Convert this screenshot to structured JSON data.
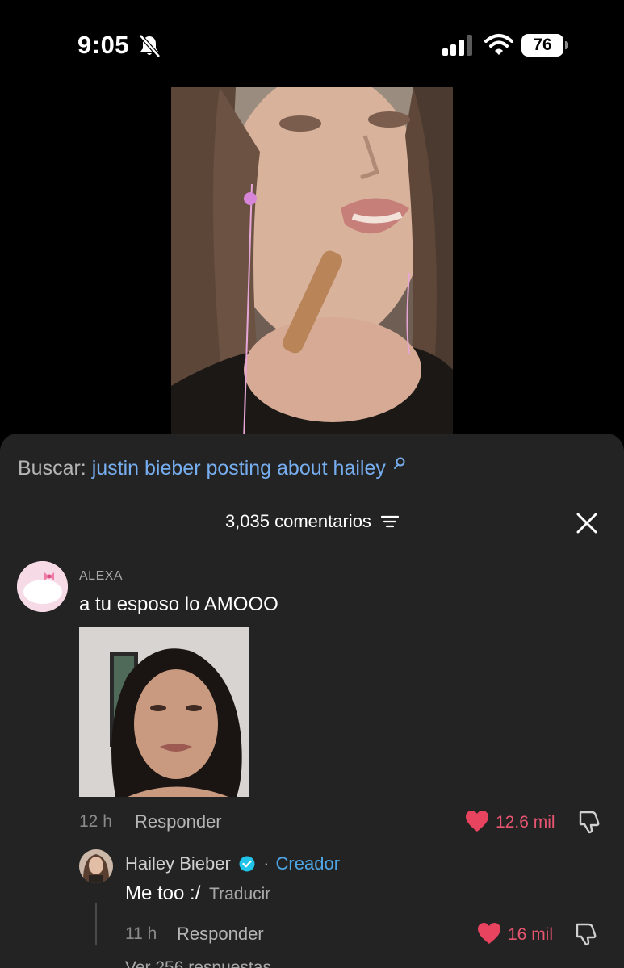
{
  "status_bar": {
    "time": "9:05",
    "battery": "76",
    "icons": [
      "bell-muted-icon",
      "cellular-signal-icon",
      "wifi-icon",
      "battery-icon"
    ]
  },
  "video": {
    "description_icon": "video-thumbnail"
  },
  "search": {
    "prefix": "Buscar:",
    "query": "justin bieber posting about hailey",
    "icon": "search-icon"
  },
  "comments_header": {
    "count_label": "3,035 comentarios",
    "filter_icon": "filter-icon",
    "close_icon": "close-icon"
  },
  "comments": [
    {
      "username": "ALEXA",
      "text": "a tu esposo lo AMOOO",
      "time": "12 h",
      "reply_label": "Responder",
      "likes": "12.6 mil",
      "liked": true
    }
  ],
  "reply": {
    "name": "Hailey Bieber",
    "badge": "·",
    "creator_label": "Creador",
    "text": "Me too :/",
    "translate_label": "Traducir",
    "time": "11 h",
    "reply_label": "Responder",
    "likes": "16 mil",
    "liked": true
  },
  "more_replies": "Ver 256 respuestas",
  "colors": {
    "sheet_bg": "#232323",
    "accent_blue": "#77aef0",
    "creator_blue": "#4fa6e6",
    "like_red": "#e85570"
  }
}
